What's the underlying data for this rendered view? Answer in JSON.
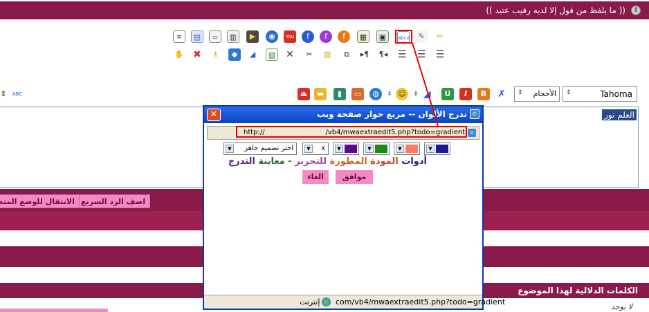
{
  "topbar": {
    "quote": "(( ما يلفظ من قول إلا لديه رقيب عتيد ))"
  },
  "toolbar": {
    "font_value": "Tahoma",
    "size_value": "الأحجام",
    "spell_label": "ABC",
    "colors": {
      "youtube": "#d83020",
      "flash": "#e0402a",
      "flash_purple": "#9a3ad8",
      "blue": "#2a5ad8",
      "green": "#2a9a3a",
      "red": "#d83020",
      "orange": "#e87a1a"
    }
  },
  "editor": {
    "content": "العلم نور"
  },
  "buttons": {
    "quick_reply": "اضف الرد السريع",
    "advanced_mode": "الانتقال للوضع المتطو"
  },
  "tags_section": {
    "title": "الكلمات الدلالية لهذا الموضوع",
    "none_text": "لا يوجد"
  },
  "popup": {
    "title": "تدرج الألوان -- مربع حوار صفحة ويب",
    "address_left": "http://",
    "address_right": "/vb4/mwaextraedit5.php?todo=gradient",
    "x_value": "x",
    "preset_placeholder": "اختر تصميم جاهز",
    "swatches": [
      "#1a1a8a",
      "#ff7a5a",
      "#1a8a1a",
      "#5a0a8a"
    ],
    "preview_parts": [
      {
        "text": "أدوات",
        "color": "#1a1a8a"
      },
      {
        "text": " المودة ",
        "color": "#c04a2a"
      },
      {
        "text": "المطورة",
        "color": "#c06a2a"
      },
      {
        "text": " للتحرير",
        "color": "#a04a9a"
      },
      {
        "text": " - ",
        "color": "#2a7a2a"
      },
      {
        "text": "معاينة",
        "color": "#2a6a2a"
      },
      {
        "text": " التدرج",
        "color": "#5a1a7a"
      }
    ],
    "ok_label": "موافق",
    "cancel_label": "الغاء",
    "status_url": "com/vb4/mwaextraedit5.php?todo=gradient",
    "status_zone": "إنترنت"
  }
}
